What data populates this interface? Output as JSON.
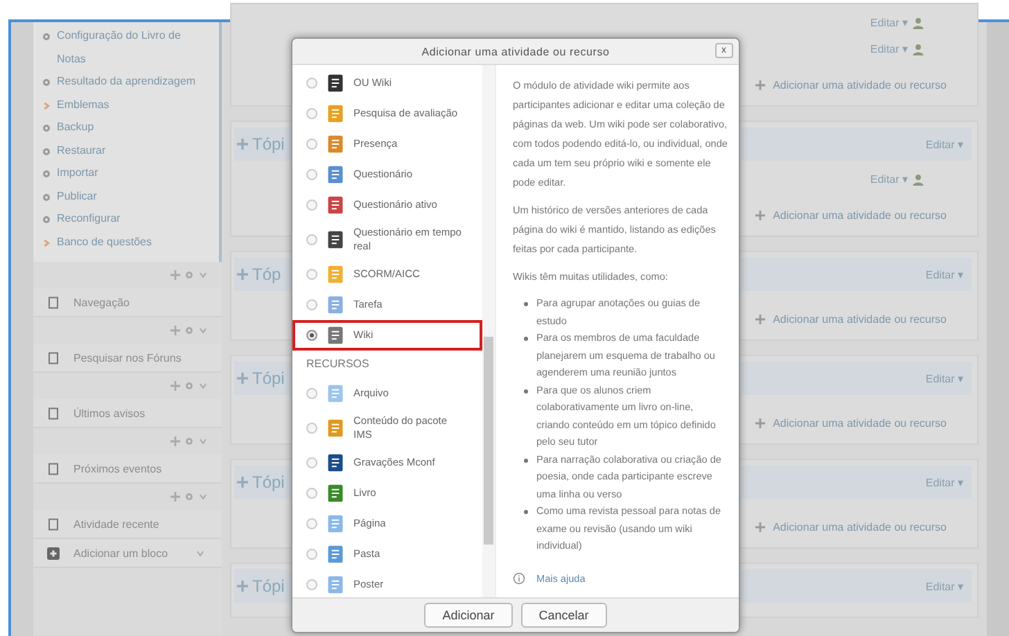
{
  "sidebar": {
    "settings_items": [
      {
        "kind": "action",
        "label": "Configuração do Livro de Notas"
      },
      {
        "kind": "action",
        "label": "Resultado da aprendizagem"
      },
      {
        "kind": "branch",
        "label": "Emblemas"
      },
      {
        "kind": "action",
        "label": "Backup"
      },
      {
        "kind": "action",
        "label": "Restaurar"
      },
      {
        "kind": "action",
        "label": "Importar"
      },
      {
        "kind": "action",
        "label": "Publicar"
      },
      {
        "kind": "action",
        "label": "Reconfigurar"
      },
      {
        "kind": "branch",
        "label": "Banco de questões"
      }
    ],
    "blocks": [
      {
        "kind": "block",
        "title": "Navegação"
      },
      {
        "kind": "block",
        "title": "Pesquisar nos Fóruns"
      },
      {
        "kind": "block",
        "title": "Últimos avisos"
      },
      {
        "kind": "block",
        "title": "Próximos eventos"
      },
      {
        "kind": "block",
        "title": "Atividade recente"
      },
      {
        "kind": "add",
        "title": "Adicionar um bloco"
      }
    ]
  },
  "sections": [
    {
      "activities": [
        "Editar ▾",
        "Editar ▾"
      ],
      "add_link": "Adicionar uma atividade ou recurso"
    },
    {
      "title": "Tópi",
      "header_action": "Editar ▾",
      "activities": [
        "Editar ▾"
      ],
      "add_link": "Adicionar uma atividade ou recurso"
    },
    {
      "title": "Tóp",
      "header_action": "Editar ▾",
      "add_link": "Adicionar uma atividade ou recurso"
    },
    {
      "title": "Tópi",
      "header_action": "Editar ▾",
      "add_link": "Adicionar uma atividade ou recurso"
    },
    {
      "title": "Tópi",
      "header_action": "Editar ▾",
      "add_link": "Adicionar uma atividade ou recurso"
    },
    {
      "title": "Tópi",
      "header_action": "Editar ▾"
    }
  ],
  "dialog": {
    "title": "Adicionar uma atividade ou recurso",
    "close": "x",
    "items": [
      {
        "kind": "item",
        "label": "OU Wiki",
        "selected": false
      },
      {
        "kind": "item",
        "label": "Pesquisa de avaliação",
        "selected": false
      },
      {
        "kind": "item",
        "label": "Presença",
        "selected": false
      },
      {
        "kind": "item",
        "label": "Questionário",
        "selected": false
      },
      {
        "kind": "item",
        "label": "Questionário ativo",
        "selected": false
      },
      {
        "kind": "item",
        "label": "Questionário em tempo real",
        "selected": false
      },
      {
        "kind": "item",
        "label": "SCORM/AICC",
        "selected": false
      },
      {
        "kind": "item",
        "label": "Tarefa",
        "selected": false
      },
      {
        "kind": "item",
        "label": "Wiki",
        "selected": true
      },
      {
        "kind": "heading",
        "label": "RECURSOS"
      },
      {
        "kind": "item",
        "label": "Arquivo",
        "selected": false
      },
      {
        "kind": "item",
        "label": "Conteúdo do pacote IMS",
        "selected": false
      },
      {
        "kind": "item",
        "label": "Gravações Mconf",
        "selected": false
      },
      {
        "kind": "item",
        "label": "Livro",
        "selected": false
      },
      {
        "kind": "item",
        "label": "Página",
        "selected": false
      },
      {
        "kind": "item",
        "label": "Pasta",
        "selected": false
      },
      {
        "kind": "item",
        "label": "Poster",
        "selected": false
      }
    ],
    "description": {
      "paragraphs": [
        "O módulo de atividade wiki permite aos participantes adicionar e editar uma coleção de páginas da web. Um wiki pode ser colaborativo, com todos podendo editá-lo, ou individual, onde cada um tem seu próprio wiki e somente ele pode editar.",
        "Um histórico de versões anteriores de cada página do wiki é mantido, listando as edições feitas por cada participante.",
        "Wikis têm muitas utilidades, como:"
      ],
      "bullets": [
        "Para agrupar anotações ou guias de estudo",
        "Para os membros de uma faculdade planejarem um esquema de trabalho ou agenderem uma reunião juntos",
        "Para que os alunos criem colaborativamente um livro on-line, criando conteúdo em um tópico definido pelo seu tutor",
        "Para narração colaborativa ou criação de poesia, onde cada participante escreve uma linha ou verso",
        "Como uma revista pessoal para notas de exame ou revisão (usando um wiki individual)"
      ],
      "help_link": "Mais ajuda"
    },
    "buttons": [
      "Adicionar",
      "Cancelar"
    ]
  }
}
